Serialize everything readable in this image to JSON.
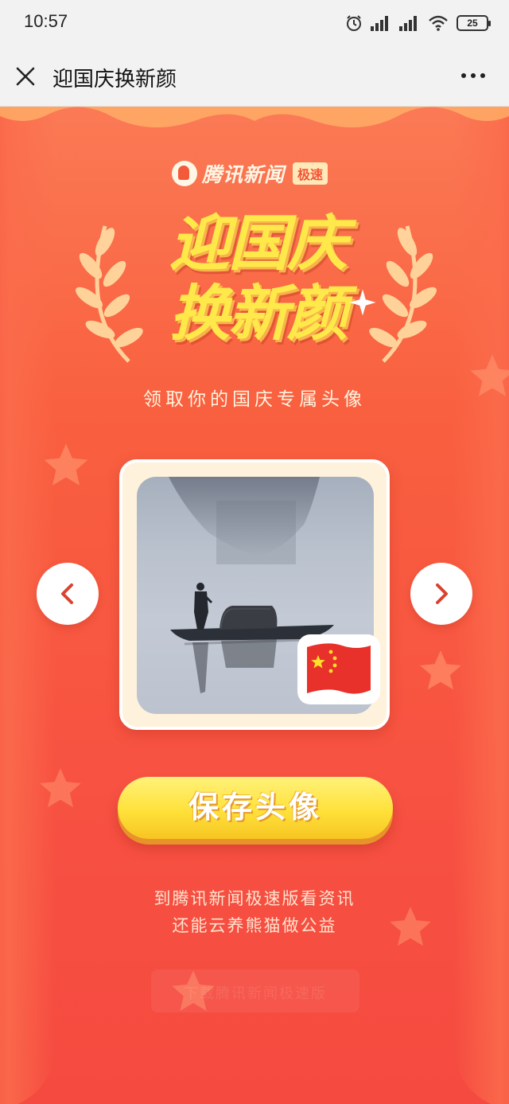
{
  "status_bar": {
    "time": "10:57",
    "battery": "25",
    "icons": [
      "alarm-icon",
      "signal-icon",
      "signal-icon",
      "wifi-icon",
      "battery-icon"
    ]
  },
  "nav": {
    "close_icon": "close-icon",
    "title": "迎国庆换新颜",
    "more_icon": "more-icon"
  },
  "brand": {
    "name": "腾讯新闻",
    "badge": "极速"
  },
  "headline": {
    "line1": "迎国庆",
    "line2": "换新颜",
    "subtitle": "领取你的国庆专属头像"
  },
  "carousel": {
    "prev_icon": "chevron-left-icon",
    "next_icon": "chevron-right-icon",
    "flag_badge": "chinese-flag-icon"
  },
  "actions": {
    "save_label": "保存头像"
  },
  "promo": {
    "line1": "到腾讯新闻极速版看资讯",
    "line2": "还能云养熊猫做公益",
    "faded_button": "下载腾讯新闻极速版"
  },
  "colors": {
    "background": "#f65a44",
    "accent_yellow": "#ffe13a",
    "arrow_red": "#d9422f"
  }
}
